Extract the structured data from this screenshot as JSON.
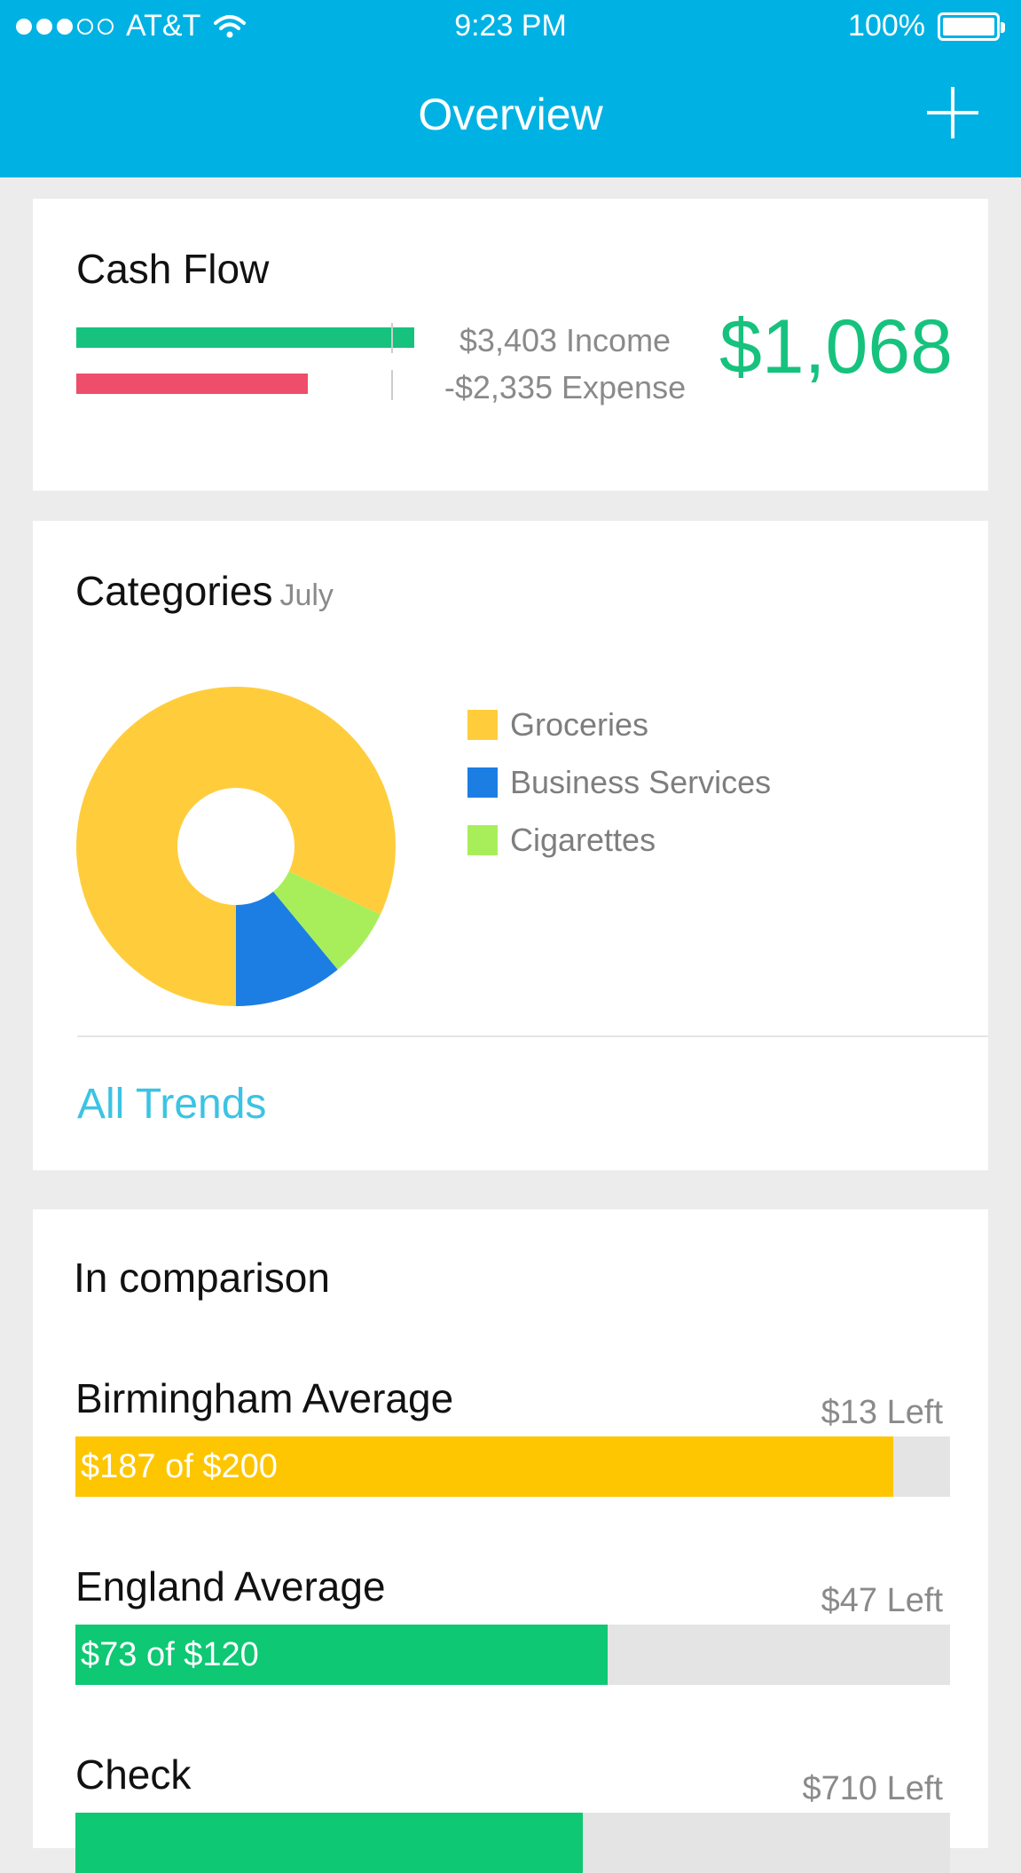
{
  "status_bar": {
    "carrier": "AT&T",
    "time": "9:23 PM",
    "battery": "100%"
  },
  "nav": {
    "title": "Overview"
  },
  "cash_flow": {
    "title": "Cash Flow",
    "income_label": "$3,403 Income",
    "expense_label": "-$2,335 Expense",
    "net_amount": "$1,068",
    "income_value": 3403,
    "expense_value": 2335,
    "income_color": "#16c27d",
    "expense_color": "#ee4d6b"
  },
  "categories": {
    "title": "Categories",
    "period": "July",
    "all_trends_label": "All Trends",
    "legend": [
      {
        "label": "Groceries",
        "color": "#ffcd3c"
      },
      {
        "label": "Business Services",
        "color": "#1c7ee3"
      },
      {
        "label": "Cigarettes",
        "color": "#a8ee5a"
      }
    ]
  },
  "chart_data": {
    "type": "pie",
    "categories": [
      "Groceries",
      "Business Services",
      "Cigarettes"
    ],
    "values": [
      82,
      11,
      7
    ],
    "colors": [
      "#ffcd3c",
      "#1c7ee3",
      "#a8ee5a"
    ],
    "donut": true
  },
  "comparison": {
    "title": "In comparison",
    "rows": [
      {
        "name": "Birmingham Average",
        "left": "$13 Left",
        "progress": "$187 of $200",
        "fraction": 0.935,
        "color": "#fec600"
      },
      {
        "name": "England Average",
        "left": "$47 Left",
        "progress": "$73 of $120",
        "fraction": 0.6083,
        "color": "#0ec874"
      },
      {
        "name": "Check",
        "left": "$710 Left",
        "progress": "",
        "fraction": 0.58,
        "color": "#0ec874"
      }
    ]
  }
}
